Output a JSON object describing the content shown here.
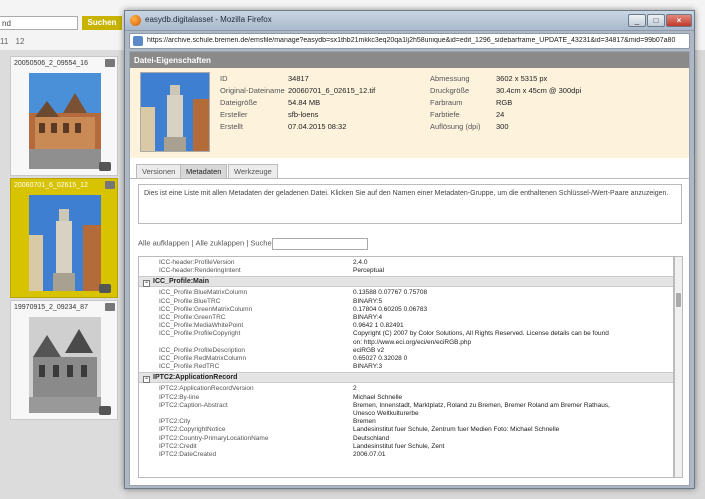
{
  "background": {
    "search_value": "nd",
    "search_button": "Suchen",
    "pages": [
      "11",
      "12"
    ],
    "cards": [
      {
        "title": "20050506_2_09554_16",
        "selected": false
      },
      {
        "title": "20060701_6_02615_12",
        "selected": true
      },
      {
        "title": "19970915_2_09234_87",
        "selected": false
      }
    ]
  },
  "window": {
    "title": "easydb.digitalasset - Mozilla Firefox",
    "url": "https://archive.schule.bremen.de/emsfile/manage?easydb=sx1thb21mkkc3eq20qa1lj2h58unique&id=edit_1296_sidebarframe_UPDATE_43231&id=34817&mid=99b07a80",
    "buttons": {
      "minimize": "_",
      "maximize": "□",
      "close": "×"
    }
  },
  "dialog": {
    "header": "Datei-Eigenschaften",
    "info_left": [
      {
        "label": "ID",
        "value": "34817"
      },
      {
        "label": "Original-Dateiname",
        "value": "20060701_6_02615_12.tif"
      },
      {
        "label": "Dateigröße",
        "value": "54.84 MB"
      },
      {
        "label": "Ersteller",
        "value": "sfb-loens"
      },
      {
        "label": "Erstellt",
        "value": "07.04.2015 08:32"
      }
    ],
    "info_right": [
      {
        "label": "Abmessung",
        "value": "3602 x 5315 px"
      },
      {
        "label": "Druckgröße",
        "value": "30.4cm x 45cm @ 300dpi"
      },
      {
        "label": "Farbraum",
        "value": "RGB"
      },
      {
        "label": "Farbtiefe",
        "value": "24"
      },
      {
        "label": "Auflösung (dpi)",
        "value": "300"
      }
    ],
    "tabs": [
      "Versionen",
      "Metadaten",
      "Werkzeuge"
    ],
    "active_tab": "Metadaten",
    "description": "Dies ist eine Liste mit allen Metadaten der geladenen Datei. Klicken Sie auf den Namen einer Metadaten-Gruppe, um die enthaltenen Schlüssel-/Wert-Paare anzuzeigen.",
    "filter": {
      "expand_all": "Alle aufklappen",
      "collapse_all": "Alle zuklappen",
      "search_label": "Suche",
      "search_value": ""
    },
    "metadata": [
      {
        "type": "row",
        "key": "ICC-header:ProfileVersion",
        "value": "2.4.0"
      },
      {
        "type": "row",
        "key": "ICC-header:RenderingIntent",
        "value": "Perceptual"
      },
      {
        "type": "group",
        "label": "ICC_Profile:Main"
      },
      {
        "type": "row",
        "key": "ICC_Profile:BlueMatrixColumn",
        "value": "0.13588 0.07767 0.75708"
      },
      {
        "type": "row",
        "key": "ICC_Profile:BlueTRC",
        "value": "BINARY:5"
      },
      {
        "type": "row",
        "key": "ICC_Profile:GreenMatrixColumn",
        "value": "0.17804 0.60205 0.06783"
      },
      {
        "type": "row",
        "key": "ICC_Profile:GreenTRC",
        "value": "BINARY:4"
      },
      {
        "type": "row",
        "key": "ICC_Profile:MediaWhitePoint",
        "value": "0.9642 1 0.82491"
      },
      {
        "type": "row",
        "key": "ICC_Profile:ProfileCopyright",
        "value": "Copyright (C) 2007 by Color Solutions, All Rights Reserved. License details can be found"
      },
      {
        "type": "row",
        "key": "",
        "value": "on: http://www.eci.org/eci/en/eciRGB.php"
      },
      {
        "type": "row",
        "key": "ICC_Profile:ProfileDescription",
        "value": "eciRGB v2"
      },
      {
        "type": "row",
        "key": "ICC_Profile:RedMatrixColumn",
        "value": "0.65027 0.32028 0"
      },
      {
        "type": "row",
        "key": "ICC_Profile:RedTRC",
        "value": "BINARY:3"
      },
      {
        "type": "group",
        "label": "IPTC2:ApplicationRecord"
      },
      {
        "type": "row",
        "key": "IPTC2:ApplicationRecordVersion",
        "value": "2"
      },
      {
        "type": "row",
        "key": "IPTC2:By-line",
        "value": "Michael Schnelle"
      },
      {
        "type": "row",
        "key": "IPTC2:Caption-Abstract",
        "value": "Bremen, Innenstadt, Marktplatz, Roland zu Bremen, Bremer Roland am Bremer Rathaus,"
      },
      {
        "type": "row",
        "key": "",
        "value": "Unesco Weltkulturerbe"
      },
      {
        "type": "row",
        "key": "IPTC2:City",
        "value": "Bremen"
      },
      {
        "type": "row",
        "key": "IPTC2:CopyrightNotice",
        "value": "Landesinstitut fuer Schule, Zentrum fuer Medien Foto: Michael Schnelle"
      },
      {
        "type": "row",
        "key": "IPTC2:Country-PrimaryLocationName",
        "value": "Deutschland"
      },
      {
        "type": "row",
        "key": "IPTC2:Credit",
        "value": "Landesinstitut fuer Schule, Zent"
      },
      {
        "type": "row",
        "key": "IPTC2:DateCreated",
        "value": "2006.07.01"
      }
    ]
  }
}
